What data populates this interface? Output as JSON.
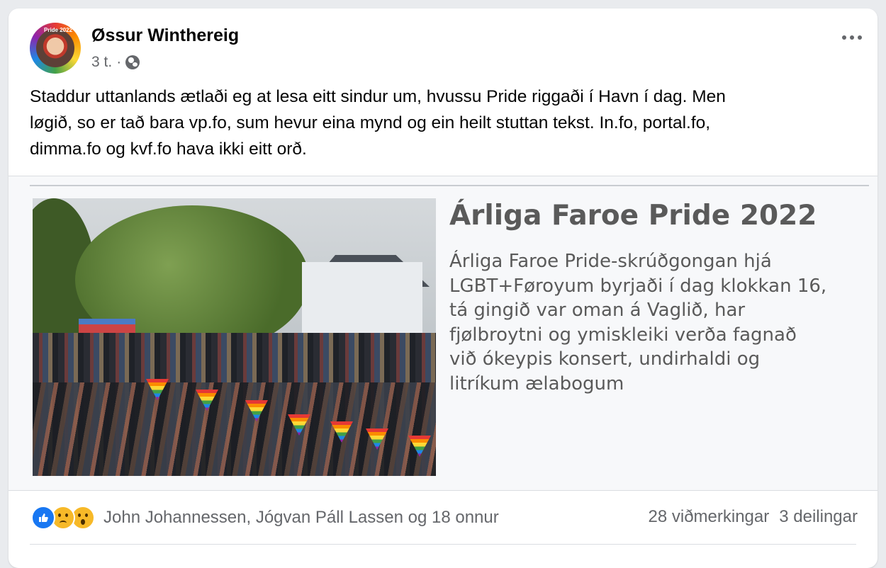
{
  "post": {
    "author": "Øssur Winthereig",
    "time": "3 t.",
    "separator": "·",
    "privacy_icon": "globe-icon",
    "avatar_text": "Pride 2022",
    "text_lines": [
      "Staddur uttanlands ætlaði eg at lesa eitt sindur um, hvussu Pride riggaði í Havn í dag. Men",
      "løgið, so er tað bara vp.fo, sum hevur eina mynd og ein heilt stuttan tekst. In.fo, portal.fo,",
      "dimma.fo og kvf.fo hava ikki eitt orð."
    ]
  },
  "link_preview": {
    "title": "Árliga Faroe Pride 2022",
    "description_lines": [
      "Árliga Faroe Pride-skrúðgongan hjá",
      "LGBT+Føroyum byrjaði í dag klokkan 16,",
      "tá gingið var oman á Vaglið, har",
      "fjølbroytni og ymiskleiki verða fagnað",
      "við ókeypis konsert, undirhaldi og",
      "litríkum ælabogum"
    ],
    "image_description": "Pride parade crowd with rainbow flags in front of a white house"
  },
  "engagement": {
    "reaction_icons": [
      "like-icon",
      "sad-icon",
      "wow-icon"
    ],
    "reactors": "John Johannessen, Jógvan Páll Lassen og 18 onnur",
    "comments": "28 viðmerkingar",
    "shares": "3 deilingar"
  },
  "colors": {
    "accent": "#1877f2",
    "secondary_text": "#65676b",
    "reaction_yellow": "#f7b928"
  }
}
